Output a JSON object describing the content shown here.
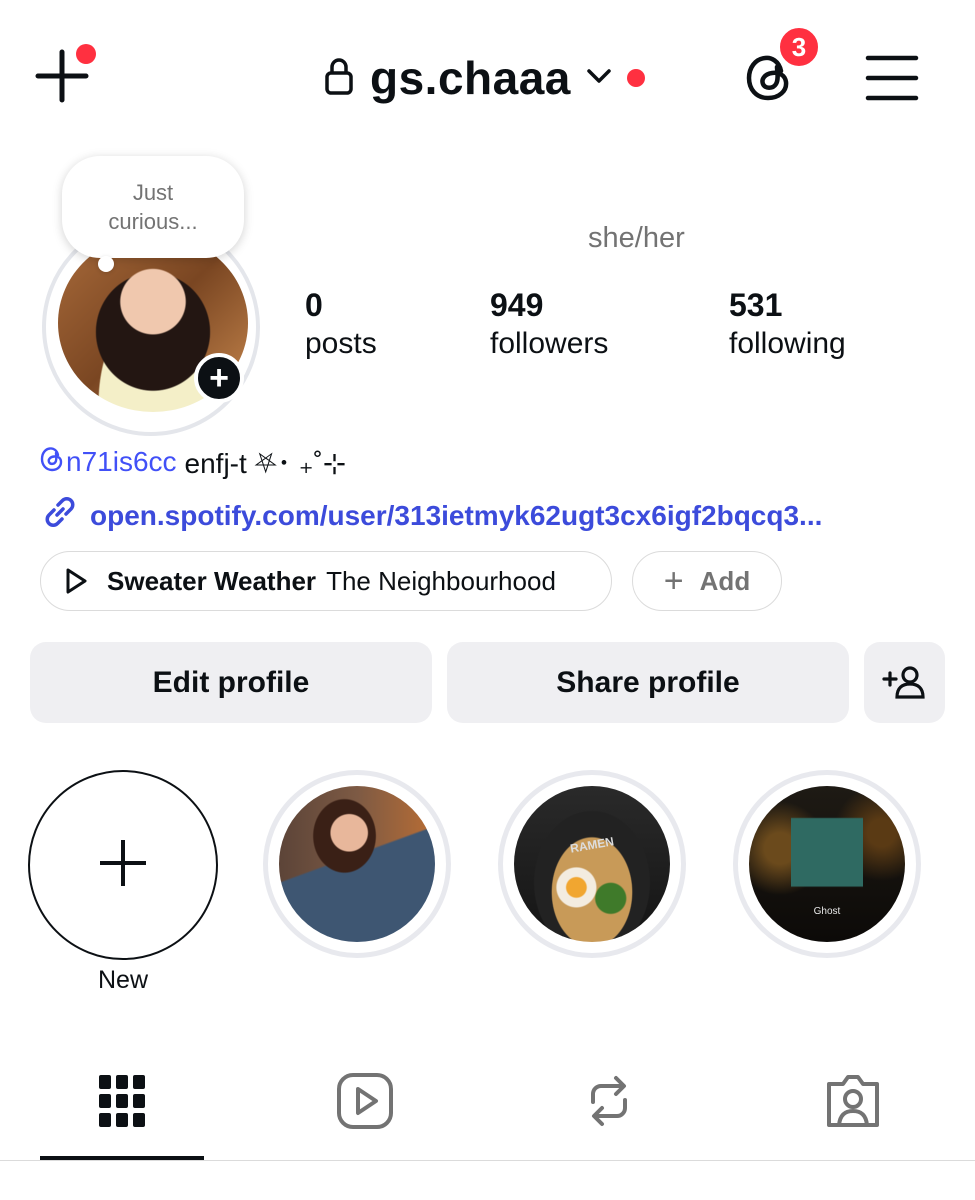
{
  "header": {
    "username": "gs.chaaa",
    "threads_badge_count": "3"
  },
  "profile": {
    "note_line1": "Just",
    "note_line2": "curious...",
    "pronouns": "she/her",
    "stats": {
      "posts_value": "0",
      "posts_label": "posts",
      "followers_value": "949",
      "followers_label": "followers",
      "following_value": "531",
      "following_label": "following"
    },
    "bio": {
      "threads_handle": "n71is6cc",
      "text": "enfj-t ⛧･ ₊˚⊹"
    },
    "link": "open.spotify.com/user/313ietmyk62ugt3cx6igf2bqcq3...",
    "music": {
      "song": "Sweater Weather",
      "artist": "The Neighbourhood"
    },
    "add_label": "Add"
  },
  "buttons": {
    "edit": "Edit profile",
    "share": "Share profile"
  },
  "highlights": {
    "new_label": "New",
    "items": [
      {
        "name": "highlight-portrait"
      },
      {
        "name": "highlight-ramen",
        "text": "RAMEN"
      },
      {
        "name": "highlight-music",
        "text": "Ghost"
      }
    ]
  },
  "tabs": [
    "grid",
    "reels",
    "reposts",
    "tagged"
  ],
  "colors": {
    "accent_link": "#3c4bdb",
    "notification_red": "#ff3040",
    "button_bg": "#efeff2"
  }
}
